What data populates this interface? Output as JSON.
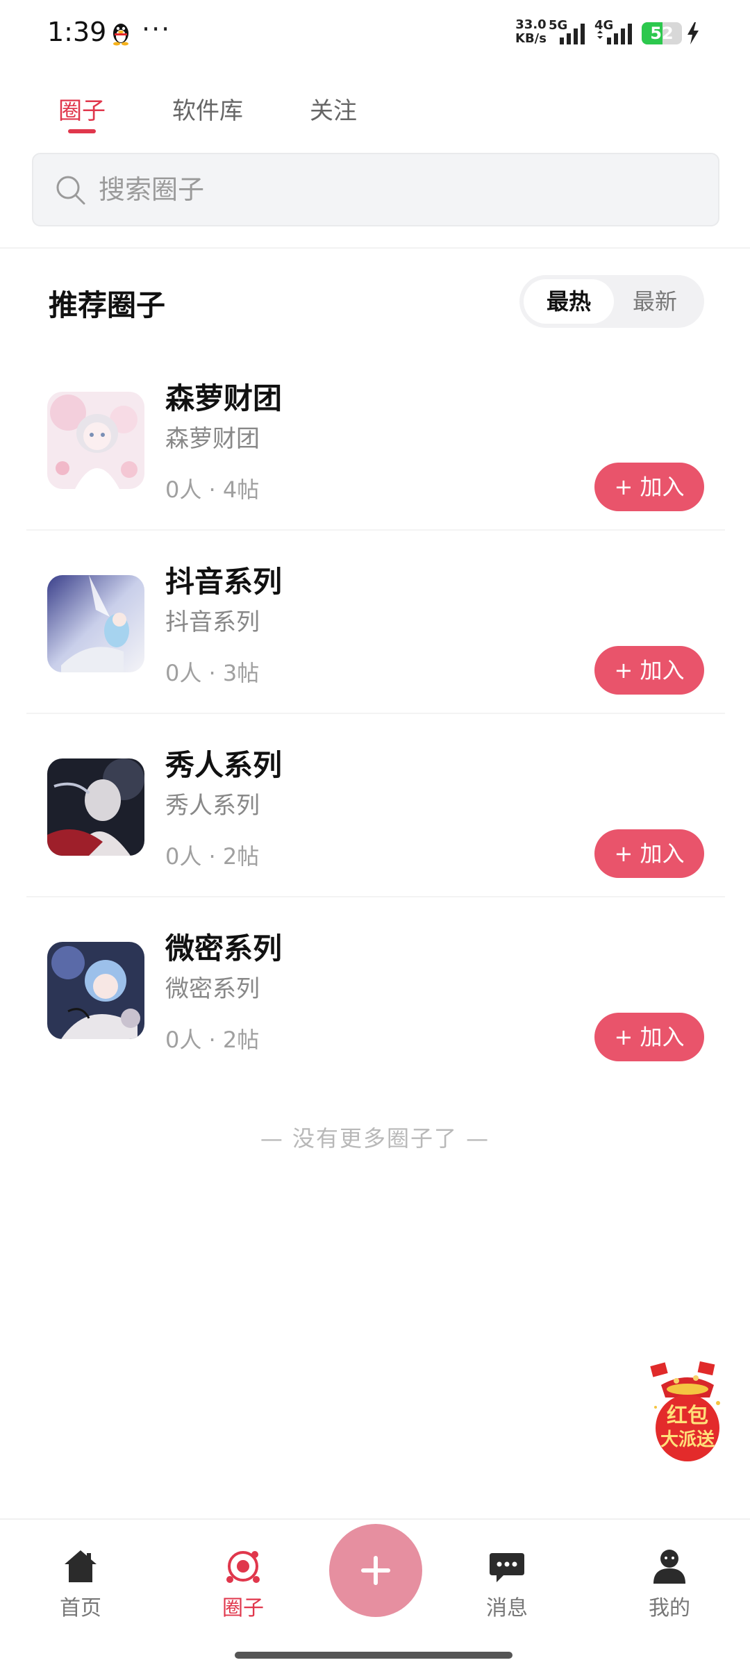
{
  "status_bar": {
    "time": "1:39",
    "speed_value": "33.0",
    "speed_unit": "KB/s",
    "network_1": "5G",
    "network_2": "4G",
    "battery_level": "52",
    "battery_percent": 52,
    "more_icon": "more-dots-icon",
    "qq_icon": "qq-penguin-icon",
    "charging_icon": "charging-bolt-icon"
  },
  "tabs": [
    {
      "label": "圈子",
      "active": true
    },
    {
      "label": "软件库",
      "active": false
    },
    {
      "label": "关注",
      "active": false
    }
  ],
  "search": {
    "placeholder": "搜索圈子",
    "icon": "search-icon"
  },
  "section": {
    "title": "推荐圈子",
    "sort_options": [
      "最热",
      "最新"
    ],
    "selected_sort": "最热"
  },
  "circles": [
    {
      "name": "森萝财团",
      "desc": "森萝财团",
      "stats": "0人 · 4帖",
      "join_label": "+ 加入"
    },
    {
      "name": "抖音系列",
      "desc": "抖音系列",
      "stats": "0人 · 3帖",
      "join_label": "+ 加入"
    },
    {
      "name": "秀人系列",
      "desc": "秀人系列",
      "stats": "0人 · 2帖",
      "join_label": "+ 加入"
    },
    {
      "name": "微密系列",
      "desc": "微密系列",
      "stats": "0人 · 2帖",
      "join_label": "+ 加入"
    }
  ],
  "footer_text": "— 没有更多圈子了 —",
  "red_packet": {
    "line1": "红包",
    "line2": "大派送"
  },
  "bottom_nav": [
    {
      "label": "首页",
      "icon": "home-icon",
      "active": false
    },
    {
      "label": "圈子",
      "icon": "circle-target-icon",
      "active": true
    },
    {
      "label": "消息",
      "icon": "message-bubble-icon",
      "active": false
    },
    {
      "label": "我的",
      "icon": "profile-icon",
      "active": false
    }
  ],
  "colors": {
    "accent": "#e0374c",
    "join_button": "#e9546b",
    "fab": "#e68fa0"
  }
}
